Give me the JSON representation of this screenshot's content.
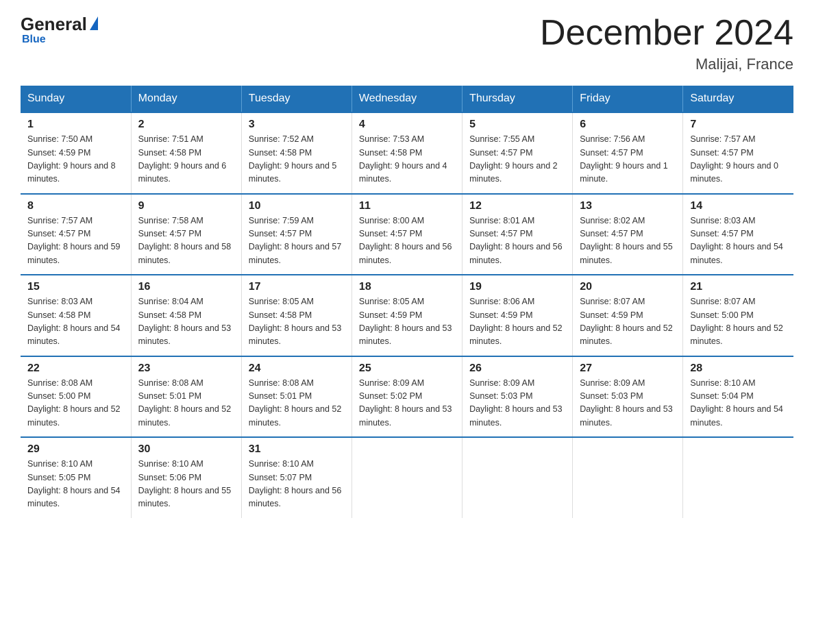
{
  "header": {
    "logo_general": "General",
    "logo_blue": "Blue",
    "month_title": "December 2024",
    "location": "Malijai, France"
  },
  "weekdays": [
    "Sunday",
    "Monday",
    "Tuesday",
    "Wednesday",
    "Thursday",
    "Friday",
    "Saturday"
  ],
  "weeks": [
    [
      {
        "day": "1",
        "sunrise": "7:50 AM",
        "sunset": "4:59 PM",
        "daylight": "9 hours and 8 minutes."
      },
      {
        "day": "2",
        "sunrise": "7:51 AM",
        "sunset": "4:58 PM",
        "daylight": "9 hours and 6 minutes."
      },
      {
        "day": "3",
        "sunrise": "7:52 AM",
        "sunset": "4:58 PM",
        "daylight": "9 hours and 5 minutes."
      },
      {
        "day": "4",
        "sunrise": "7:53 AM",
        "sunset": "4:58 PM",
        "daylight": "9 hours and 4 minutes."
      },
      {
        "day": "5",
        "sunrise": "7:55 AM",
        "sunset": "4:57 PM",
        "daylight": "9 hours and 2 minutes."
      },
      {
        "day": "6",
        "sunrise": "7:56 AM",
        "sunset": "4:57 PM",
        "daylight": "9 hours and 1 minute."
      },
      {
        "day": "7",
        "sunrise": "7:57 AM",
        "sunset": "4:57 PM",
        "daylight": "9 hours and 0 minutes."
      }
    ],
    [
      {
        "day": "8",
        "sunrise": "7:57 AM",
        "sunset": "4:57 PM",
        "daylight": "8 hours and 59 minutes."
      },
      {
        "day": "9",
        "sunrise": "7:58 AM",
        "sunset": "4:57 PM",
        "daylight": "8 hours and 58 minutes."
      },
      {
        "day": "10",
        "sunrise": "7:59 AM",
        "sunset": "4:57 PM",
        "daylight": "8 hours and 57 minutes."
      },
      {
        "day": "11",
        "sunrise": "8:00 AM",
        "sunset": "4:57 PM",
        "daylight": "8 hours and 56 minutes."
      },
      {
        "day": "12",
        "sunrise": "8:01 AM",
        "sunset": "4:57 PM",
        "daylight": "8 hours and 56 minutes."
      },
      {
        "day": "13",
        "sunrise": "8:02 AM",
        "sunset": "4:57 PM",
        "daylight": "8 hours and 55 minutes."
      },
      {
        "day": "14",
        "sunrise": "8:03 AM",
        "sunset": "4:57 PM",
        "daylight": "8 hours and 54 minutes."
      }
    ],
    [
      {
        "day": "15",
        "sunrise": "8:03 AM",
        "sunset": "4:58 PM",
        "daylight": "8 hours and 54 minutes."
      },
      {
        "day": "16",
        "sunrise": "8:04 AM",
        "sunset": "4:58 PM",
        "daylight": "8 hours and 53 minutes."
      },
      {
        "day": "17",
        "sunrise": "8:05 AM",
        "sunset": "4:58 PM",
        "daylight": "8 hours and 53 minutes."
      },
      {
        "day": "18",
        "sunrise": "8:05 AM",
        "sunset": "4:59 PM",
        "daylight": "8 hours and 53 minutes."
      },
      {
        "day": "19",
        "sunrise": "8:06 AM",
        "sunset": "4:59 PM",
        "daylight": "8 hours and 52 minutes."
      },
      {
        "day": "20",
        "sunrise": "8:07 AM",
        "sunset": "4:59 PM",
        "daylight": "8 hours and 52 minutes."
      },
      {
        "day": "21",
        "sunrise": "8:07 AM",
        "sunset": "5:00 PM",
        "daylight": "8 hours and 52 minutes."
      }
    ],
    [
      {
        "day": "22",
        "sunrise": "8:08 AM",
        "sunset": "5:00 PM",
        "daylight": "8 hours and 52 minutes."
      },
      {
        "day": "23",
        "sunrise": "8:08 AM",
        "sunset": "5:01 PM",
        "daylight": "8 hours and 52 minutes."
      },
      {
        "day": "24",
        "sunrise": "8:08 AM",
        "sunset": "5:01 PM",
        "daylight": "8 hours and 52 minutes."
      },
      {
        "day": "25",
        "sunrise": "8:09 AM",
        "sunset": "5:02 PM",
        "daylight": "8 hours and 53 minutes."
      },
      {
        "day": "26",
        "sunrise": "8:09 AM",
        "sunset": "5:03 PM",
        "daylight": "8 hours and 53 minutes."
      },
      {
        "day": "27",
        "sunrise": "8:09 AM",
        "sunset": "5:03 PM",
        "daylight": "8 hours and 53 minutes."
      },
      {
        "day": "28",
        "sunrise": "8:10 AM",
        "sunset": "5:04 PM",
        "daylight": "8 hours and 54 minutes."
      }
    ],
    [
      {
        "day": "29",
        "sunrise": "8:10 AM",
        "sunset": "5:05 PM",
        "daylight": "8 hours and 54 minutes."
      },
      {
        "day": "30",
        "sunrise": "8:10 AM",
        "sunset": "5:06 PM",
        "daylight": "8 hours and 55 minutes."
      },
      {
        "day": "31",
        "sunrise": "8:10 AM",
        "sunset": "5:07 PM",
        "daylight": "8 hours and 56 minutes."
      },
      null,
      null,
      null,
      null
    ]
  ],
  "labels": {
    "sunrise": "Sunrise:",
    "sunset": "Sunset:",
    "daylight": "Daylight:"
  }
}
